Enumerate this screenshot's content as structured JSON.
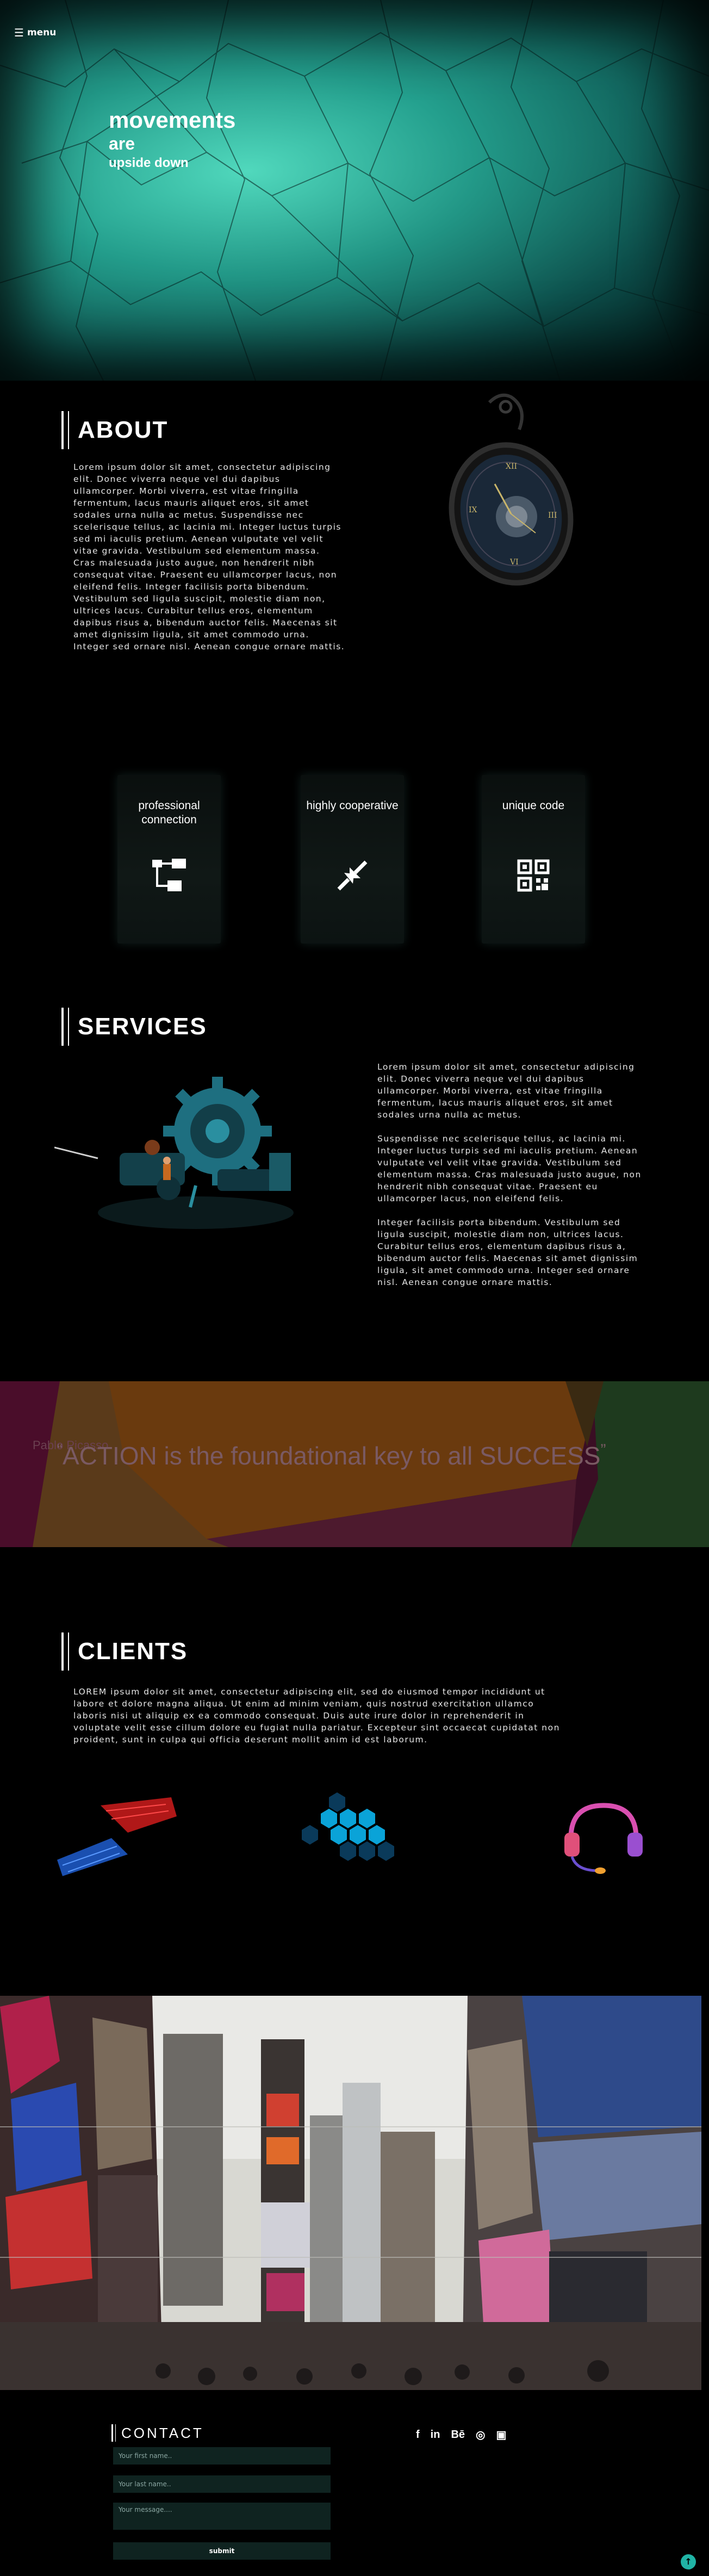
{
  "nav": {
    "menu_label": "menu"
  },
  "hero": {
    "line1": "movements",
    "line2": "are",
    "line3": "upside down"
  },
  "about": {
    "heading": "ABOUT",
    "text": "Lorem ipsum dolor sit amet, consectetur adipiscing elit. Donec viverra neque vel dui dapibus ullamcorper. Morbi viverra, est vitae fringilla fermentum, lacus mauris aliquet eros, sit amet sodales urna nulla ac metus. Suspendisse nec scelerisque tellus, ac lacinia mi. Integer luctus turpis sed mi iaculis pretium. Aenean vulputate vel velit vitae gravida. Vestibulum sed elementum massa. Cras malesuada justo augue, non hendrerit nibh consequat vitae. Praesent eu ullamcorper lacus, non eleifend felis. Integer facilisis porta bibendum. Vestibulum sed ligula suscipit, molestie diam non, ultrices lacus. Curabitur tellus eros, elementum dapibus risus a, bibendum auctor felis. Maecenas sit amet dignissim ligula, sit amet commodo urna. Integer sed ornare nisl. Aenean congue ornare mattis."
  },
  "features": [
    {
      "title": "professional connection",
      "icon": "hierarchy-icon"
    },
    {
      "title": "highly cooperative",
      "icon": "arrows-converge-icon"
    },
    {
      "title": "unique code",
      "icon": "qr-code-icon"
    }
  ],
  "services": {
    "heading": "SERVICES",
    "p1": "Lorem ipsum dolor sit amet, consectetur adipiscing elit. Donec viverra neque vel dui dapibus ullamcorper. Morbi viverra, est vitae fringilla fermentum, lacus mauris aliquet eros, sit amet sodales urna nulla ac metus.",
    "p2": "Suspendisse nec scelerisque tellus, ac lacinia mi. Integer luctus turpis sed mi iaculis pretium. Aenean vulputate vel velit vitae gravida. Vestibulum sed elementum massa. Cras malesuada justo augue, non hendrerit nibh consequat vitae. Praesent eu ullamcorper lacus, non eleifend felis.",
    "p3": "Integer facilisis porta bibendum. Vestibulum sed ligula suscipit, molestie diam non, ultrices lacus. Curabitur tellus eros, elementum dapibus risus a, bibendum auctor felis. Maecenas sit amet dignissim ligula, sit amet commodo urna. Integer sed ornare nisl. Aenean congue ornare mattis."
  },
  "quote": {
    "author": "Pablo Picasso",
    "open_mark": "“",
    "text": "ACTION is the foundational key to all SUCCESS",
    "close_mark": "”"
  },
  "clients": {
    "heading": "CLIENTS",
    "text": "LOREM ipsum dolor sit amet, consectetur adipiscing elit, sed do eiusmod tempor incididunt ut labore et dolore magna aliqua. Ut enim ad minim veniam, quis nostrud exercitation ullamco laboris nisi ut aliquip ex ea commodo consequat. Duis aute irure dolor in reprehenderit in voluptate velit esse cillum dolore eu fugiat nulla pariatur. Excepteur sint occaecat cupidatat non proident, sunt in culpa qui officia deserunt mollit anim id est laborum."
  },
  "contact": {
    "heading": "CONTACT",
    "first_name_placeholder": "Your first name..",
    "last_name_placeholder": "Your last name..",
    "message_placeholder": "Your message....",
    "submit_label": "submit"
  },
  "social": {
    "facebook": "f",
    "linkedin": "in",
    "behance": "Bē",
    "dribbble": "◎",
    "instagram": "▣"
  },
  "colors": {
    "accent": "#20b3a5",
    "field_bg": "#0f2320"
  }
}
